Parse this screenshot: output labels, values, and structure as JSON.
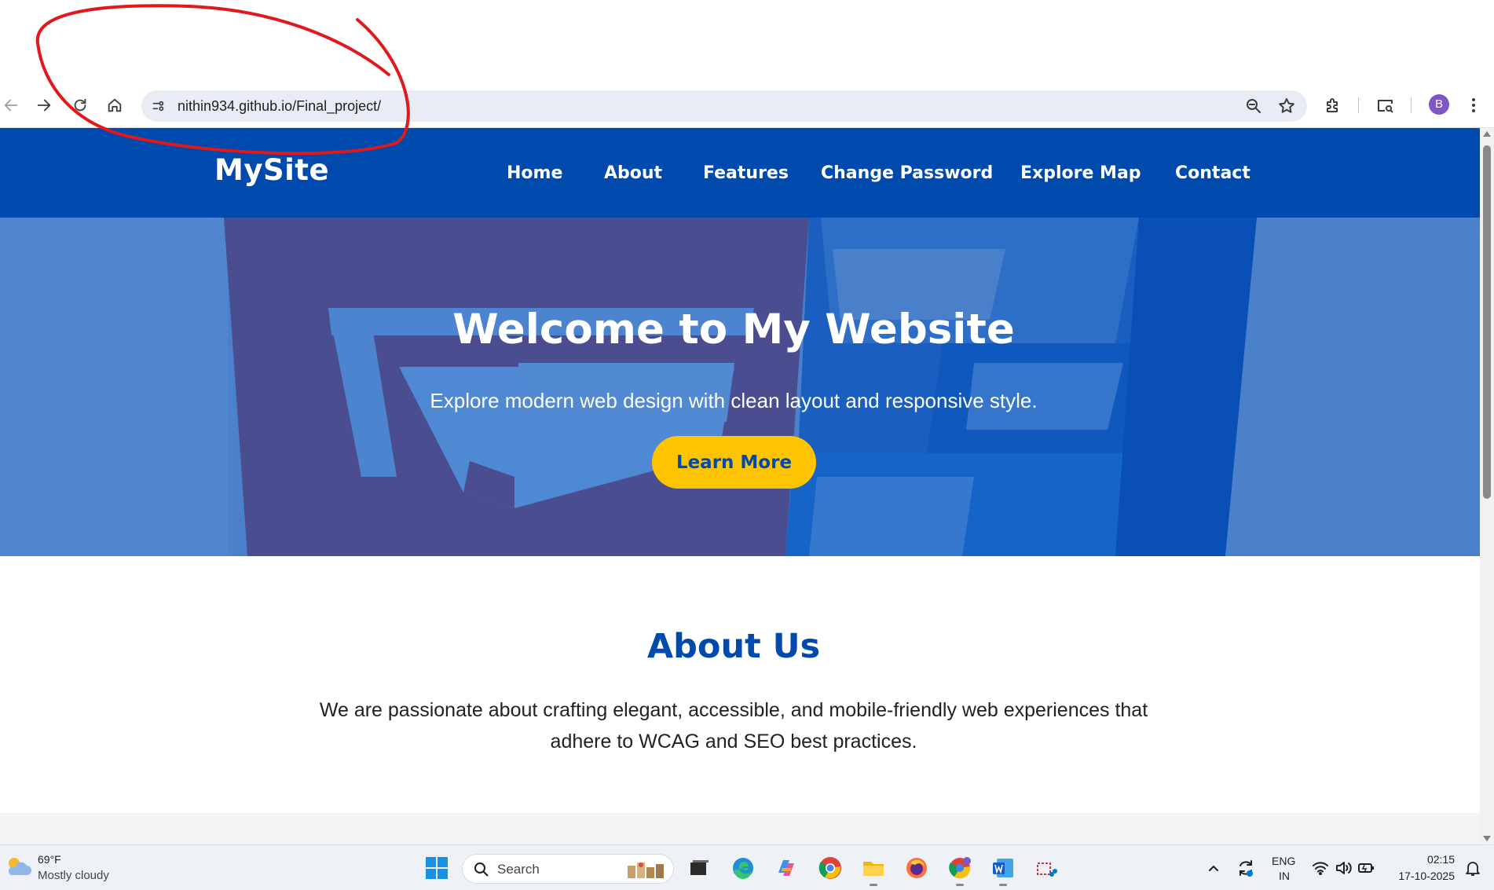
{
  "browser": {
    "url": "nithin934.github.io/Final_project/",
    "profile_initial": "B",
    "profile_color": "#7e57c2",
    "icons": [
      "back-arrow-icon",
      "forward-arrow-icon",
      "reload-icon",
      "home-icon",
      "site-info-icon",
      "zoom-out-icon",
      "bookmark-star-icon",
      "extensions-icon",
      "tab-search-icon",
      "more-menu-icon"
    ]
  },
  "annotation": {
    "color": "#e0191c"
  },
  "site": {
    "logo": "MySite",
    "nav": [
      "Home",
      "About",
      "Features",
      "Change Password",
      "Explore Map",
      "Contact"
    ],
    "header_color": "#0049ad"
  },
  "hero": {
    "title": "Welcome to My Website",
    "subtitle": "Explore modern web design with clean layout and responsive style.",
    "button": "Learn More",
    "button_color": "#ffc400"
  },
  "about": {
    "title": "About Us",
    "text": "We are passionate about crafting elegant, accessible, and mobile-friendly web experiences that adhere to WCAG and SEO best practices."
  },
  "taskbar": {
    "weather_temp": "69°F",
    "weather_condition": "Mostly cloudy",
    "search_placeholder": "Search",
    "apps": [
      "windows-start-icon",
      "task-view-icon",
      "edge-icon",
      "copilot-icon",
      "chrome-icon",
      "file-explorer-icon",
      "firefox-icon",
      "chrome-profile-icon",
      "word-icon",
      "snipping-tool-icon"
    ],
    "lang_line1": "ENG",
    "lang_line2": "IN",
    "time": "02:15",
    "date": "17-10-2025"
  }
}
